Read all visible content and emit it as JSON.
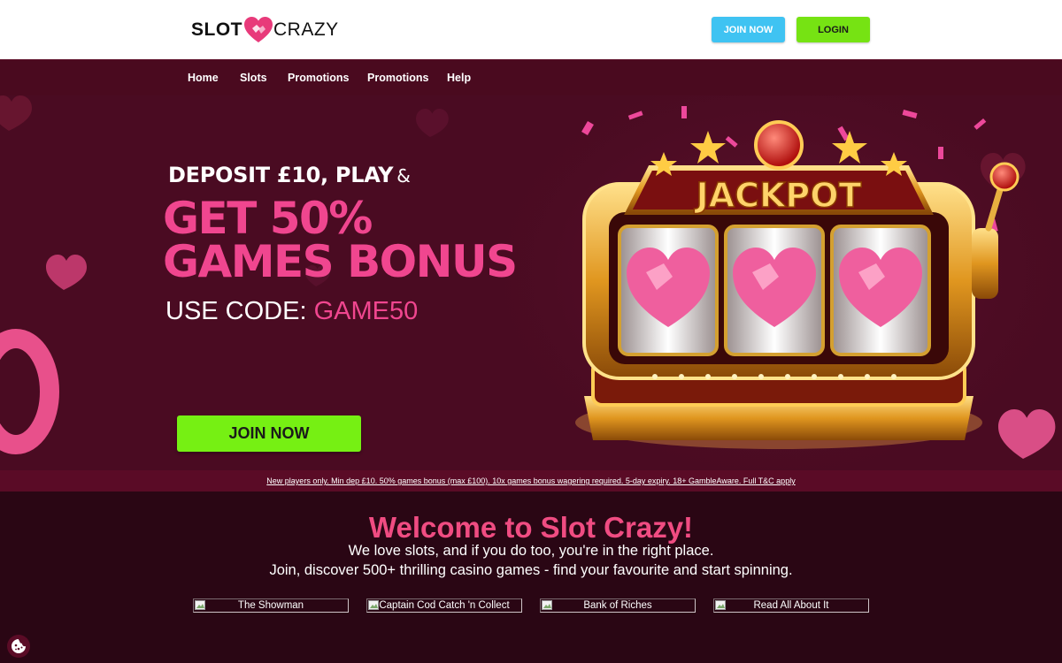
{
  "header": {
    "logo_left": "SLOT",
    "logo_right": "CRAZY",
    "join_label": "JOIN NOW",
    "login_label": "LOGIN"
  },
  "nav": {
    "items": [
      {
        "label": "Home"
      },
      {
        "label": "Slots"
      },
      {
        "label": "Promotions"
      },
      {
        "label": "Promotions"
      },
      {
        "label": "Help"
      }
    ]
  },
  "hero": {
    "line1": "DEPOSIT £10, PLAY",
    "line1_amp": "&",
    "line2": "GET 50%",
    "line3": "GAMES BONUS",
    "code_prefix": "USE CODE:",
    "code": "GAME50",
    "join_label": "JOIN NOW",
    "sign_text": "JACKPOT"
  },
  "terms": {
    "text": "New players only. Min dep £10. 50% games bonus (max £100). 10x games bonus wagering required. 5-day expiry. 18+ GambleAware. Full T&C apply"
  },
  "welcome": {
    "title": "Welcome to Slot Crazy!",
    "line1": "We love slots, and if you do too, you're in the right place.",
    "line2": "Join, discover 500+ thrilling casino games - find your favourite and start spinning."
  },
  "games": [
    {
      "title": "The Showman"
    },
    {
      "title": "Captain Cod Catch 'n Collect"
    },
    {
      "title": "Bank of Riches"
    },
    {
      "title": "Read All About It"
    }
  ],
  "colors": {
    "brand_pink": "#f0468f",
    "join_blue": "#3fc3f2",
    "login_green": "#76e313",
    "nav_bg": "#4a0a1f",
    "page_bg": "#2a0614"
  },
  "icons": {
    "logo": "heart-logo-icon",
    "cookie": "cookie-icon",
    "broken_image": "broken-image-icon"
  }
}
